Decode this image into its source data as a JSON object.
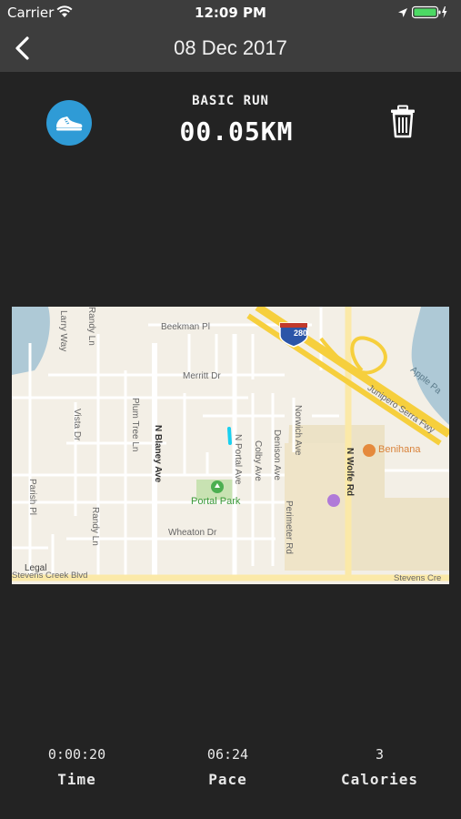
{
  "status_bar": {
    "carrier": "Carrier",
    "time": "12:09 PM"
  },
  "nav": {
    "title": "08 Dec 2017"
  },
  "run": {
    "type": "BASIC RUN",
    "distance": "00.05KM",
    "icon": "running-shoe-icon",
    "accent": "#2f9bd6"
  },
  "map": {
    "labels": {
      "beekman": "Beekman Pl",
      "merritt": "Merritt Dr",
      "wheaton": "Wheaton Dr",
      "stevens_left": "Stevens Creek Blvd",
      "stevens_right": "Stevens Cre",
      "legal": "Legal",
      "park": "Portal Park",
      "benihana": "Benihana",
      "junipero": "Junipero Serra Fwy",
      "apple": "Apple Pa",
      "i280": "280",
      "larry": "Larry Way",
      "randy_top": "Randy Ln",
      "randy_bottom": "Randy Ln",
      "vista": "Vista Dr",
      "plum": "Plum Tree Ln",
      "blaney": "N Blaney Ave",
      "portal": "N Portal Ave",
      "colby": "Colby Ave",
      "denison": "Denison Ave",
      "norwich": "Norwich Ave",
      "wolfe": "N Wolfe Rd",
      "perimeter": "Perimeter Rd",
      "parish": "Parish Pl"
    }
  },
  "stats": {
    "time_value": "0:00:20",
    "time_label": "Time",
    "pace_value": "06:24",
    "pace_label": "Pace",
    "calories_value": "3",
    "calories_label": "Calories"
  }
}
